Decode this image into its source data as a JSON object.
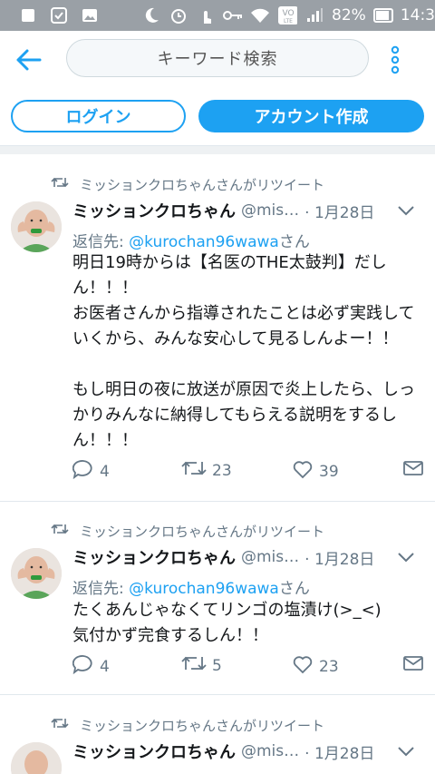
{
  "status_bar": {
    "battery_percent": "82%",
    "time": "14:3"
  },
  "header": {
    "search_placeholder": "キーワード検索"
  },
  "auth": {
    "login_label": "ログイン",
    "signup_label": "アカウント作成"
  },
  "colors": {
    "accent": "#1da1f2",
    "muted": "#657786",
    "text": "#14171a"
  },
  "tweets": [
    {
      "retweet_label": "ミッションクロちゃんさんがリツイート",
      "name": "ミッションクロちゃん",
      "handle": "@mis…",
      "date": "· 1月28日",
      "reply_prefix": "返信先: ",
      "reply_to": "@kurochan96wawa",
      "reply_suffix": "さん",
      "text": "明日19時からは【名医のTHE太鼓判】だしん！！！\nお医者さんから指導されたことは必ず実践していくから、みんな安心して見るしんよー！！\n\nもし明日の夜に放送が原因で炎上したら、しっかりみんなに納得してもらえる説明をするしん！！！",
      "replies": "4",
      "retweets": "23",
      "likes": "39"
    },
    {
      "retweet_label": "ミッションクロちゃんさんがリツイート",
      "name": "ミッションクロちゃん",
      "handle": "@mis…",
      "date": "· 1月28日",
      "reply_prefix": "返信先: ",
      "reply_to": "@kurochan96wawa",
      "reply_suffix": "さん",
      "text": "たくあんじゃなくてリンゴの塩漬け(>_<)\n気付かず完食するしん！！",
      "replies": "4",
      "retweets": "5",
      "likes": "23"
    },
    {
      "retweet_label": "ミッションクロちゃんさんがリツイート",
      "name": "ミッションクロちゃん",
      "handle": "@mis…",
      "date": "· 1月28日"
    }
  ]
}
